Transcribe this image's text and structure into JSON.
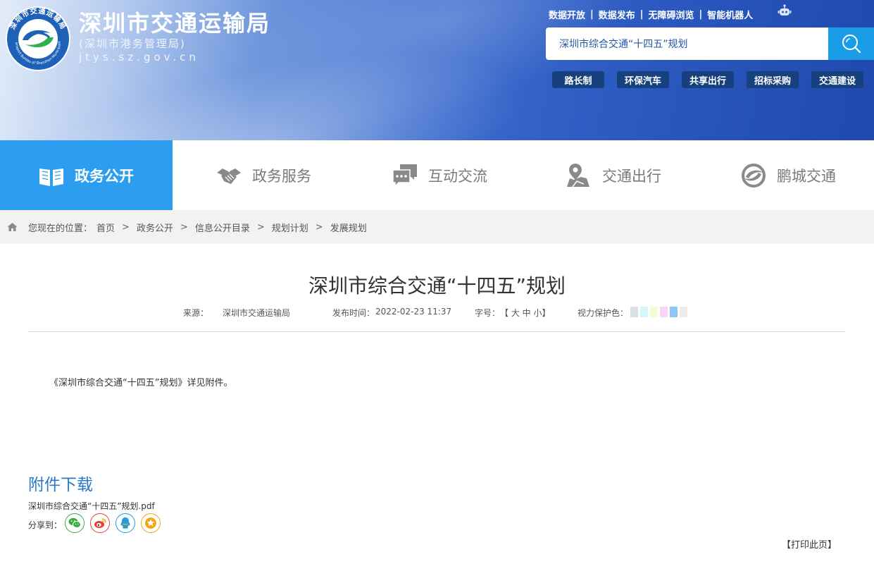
{
  "header": {
    "title": "深圳市交通运输局",
    "subtitle": "(深圳市港务管理局)",
    "domain": "jtys.sz.gov.cn",
    "logo_ring_text": "深圳市交通运输局",
    "logo_ring_text_en": "Transport Bureau of Shenzhen Municipality",
    "top_links": [
      "数据开放",
      "数据发布",
      "无障碍浏览",
      "智能机器人"
    ],
    "top_links_separator": "|",
    "robot_icon": "robot-icon",
    "search": {
      "value": "深圳市综合交通“十四五”规划",
      "button_icon": "search-icon"
    },
    "quick_tags": [
      "路长制",
      "环保汽车",
      "共享出行",
      "招标采购",
      "交通建设"
    ]
  },
  "nav": {
    "items": [
      {
        "label": "政务公开",
        "icon": "book-icon",
        "active": true
      },
      {
        "label": "政务服务",
        "icon": "handshake-icon",
        "active": false
      },
      {
        "label": "互动交流",
        "icon": "chat-icon",
        "active": false
      },
      {
        "label": "交通出行",
        "icon": "map-pin-icon",
        "active": false
      },
      {
        "label": "鹏城交通",
        "icon": "circle-logo-icon",
        "active": false
      }
    ],
    "active_color": "#2d9df0"
  },
  "breadcrumb": {
    "prefix": "您现在的位置：",
    "separator": ">",
    "items": [
      "首页",
      "政务公开",
      "信息公开目录",
      "规划计划",
      "发展规划"
    ]
  },
  "article": {
    "title": "深圳市综合交通“十四五”规划",
    "source_label": "来源：",
    "source_value": "深圳市交通运输局",
    "publish_label": "发布时间：",
    "publish_value": "2022-02-23 11:37",
    "font_size_label": "字号：",
    "font_size_options": "【 大 中 小】",
    "eye_care_label": "视力保护色：",
    "eye_care_colors": [
      "#d6e0e6",
      "#d5f6fb",
      "#f5fbd5",
      "#fbd5f5",
      "#8cc7f7",
      "#ececec"
    ],
    "body": "《深圳市综合交通“十四五”规划》详见附件。"
  },
  "attachments": {
    "heading": "附件下载",
    "file": "深圳市综合交通“十四五”规划.pdf"
  },
  "share": {
    "label": "分享到：",
    "targets": [
      {
        "icon": "wechat-icon",
        "color": "#3cae3c"
      },
      {
        "icon": "weibo-icon",
        "color": "#e6432f"
      },
      {
        "icon": "qq-icon",
        "color": "#1f9de2"
      },
      {
        "icon": "favorite-star-icon",
        "color": "#f2a516"
      }
    ]
  },
  "print": {
    "label": "【打印此页】"
  }
}
